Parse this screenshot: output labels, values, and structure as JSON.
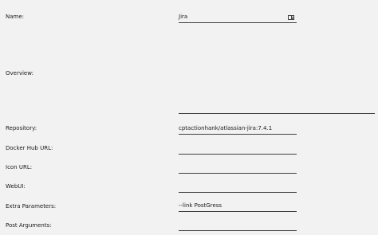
{
  "form": {
    "name": {
      "label": "Name:",
      "value": "Jira",
      "icon": "contact-card-icon"
    },
    "overview": {
      "label": "Overview:",
      "value": ""
    },
    "repository": {
      "label": "Repository:",
      "value": "cptactionhank/atlassian-jira:7.4.1"
    },
    "docker_hub_url": {
      "label": "Docker Hub URL:",
      "value": ""
    },
    "icon_url": {
      "label": "Icon URL:",
      "value": ""
    },
    "webui": {
      "label": "WebUI:",
      "value": ""
    },
    "extra_parameters": {
      "label": "Extra Parameters:",
      "value": "--link PostGress"
    },
    "post_arguments": {
      "label": "Post Arguments:",
      "value": ""
    }
  }
}
